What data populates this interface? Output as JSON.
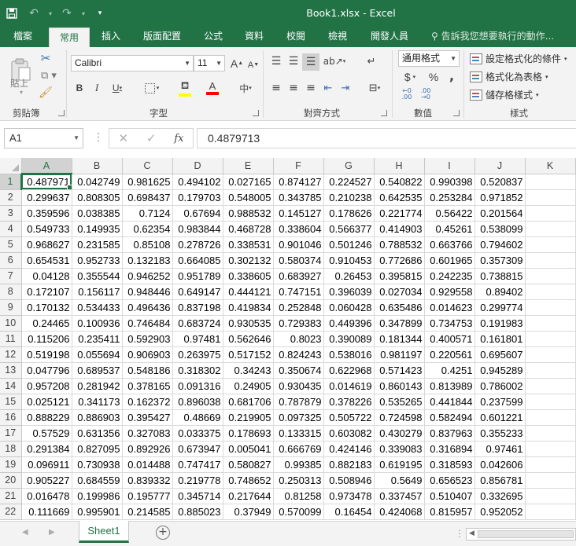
{
  "window": {
    "title": "Book1.xlsx - Excel"
  },
  "tabs": [
    {
      "label": "檔案",
      "key": "file"
    },
    {
      "label": "常用",
      "key": "home"
    },
    {
      "label": "插入",
      "key": "insert"
    },
    {
      "label": "版面配置",
      "key": "layout"
    },
    {
      "label": "公式",
      "key": "formulas"
    },
    {
      "label": "資料",
      "key": "data"
    },
    {
      "label": "校閱",
      "key": "review"
    },
    {
      "label": "檢視",
      "key": "view"
    },
    {
      "label": "開發人員",
      "key": "developer"
    }
  ],
  "tell_me": "告訴我您想要執行的動作...",
  "ribbon": {
    "clipboard": {
      "label": "剪貼簿",
      "paste": "貼上"
    },
    "font": {
      "label": "字型",
      "name": "Calibri",
      "size": "11"
    },
    "alignment": {
      "label": "對齊方式"
    },
    "number": {
      "label": "數值",
      "format": "通用格式",
      "currency": "$",
      "percent": "%",
      "comma": ","
    },
    "styles": {
      "label": "樣式",
      "conditional": "設定格式化的條件",
      "as_table": "格式化為表格",
      "cell_styles": "儲存格樣式"
    }
  },
  "formula_bar": {
    "name_box": "A1",
    "fx": "fx",
    "value": "0.4879713"
  },
  "grid": {
    "columns": [
      "A",
      "B",
      "C",
      "D",
      "E",
      "F",
      "G",
      "H",
      "I",
      "J",
      "K"
    ],
    "selected_column": "A",
    "selected_row": "1",
    "rows": [
      {
        "num": "1",
        "cells": [
          "0.487971",
          "0.042749",
          "0.981625",
          "0.494102",
          "0.027165",
          "0.874127",
          "0.224527",
          "0.540822",
          "0.990398",
          "0.520837",
          ""
        ]
      },
      {
        "num": "2",
        "cells": [
          "0.299637",
          "0.808305",
          "0.698437",
          "0.179703",
          "0.548005",
          "0.343785",
          "0.210238",
          "0.642535",
          "0.253284",
          "0.971852",
          ""
        ]
      },
      {
        "num": "3",
        "cells": [
          "0.359596",
          "0.038385",
          "0.7124",
          "0.67694",
          "0.988532",
          "0.145127",
          "0.178626",
          "0.221774",
          "0.56422",
          "0.201564",
          ""
        ]
      },
      {
        "num": "4",
        "cells": [
          "0.549733",
          "0.149935",
          "0.62354",
          "0.983844",
          "0.468728",
          "0.338604",
          "0.566377",
          "0.414903",
          "0.45261",
          "0.538099",
          ""
        ]
      },
      {
        "num": "5",
        "cells": [
          "0.968627",
          "0.231585",
          "0.85108",
          "0.278726",
          "0.338531",
          "0.901046",
          "0.501246",
          "0.788532",
          "0.663766",
          "0.794602",
          ""
        ]
      },
      {
        "num": "6",
        "cells": [
          "0.654531",
          "0.952733",
          "0.132183",
          "0.664085",
          "0.302132",
          "0.580374",
          "0.910453",
          "0.772686",
          "0.601965",
          "0.357309",
          ""
        ]
      },
      {
        "num": "7",
        "cells": [
          "0.04128",
          "0.355544",
          "0.946252",
          "0.951789",
          "0.338605",
          "0.683927",
          "0.26453",
          "0.395815",
          "0.242235",
          "0.738815",
          ""
        ]
      },
      {
        "num": "8",
        "cells": [
          "0.172107",
          "0.156117",
          "0.948446",
          "0.649147",
          "0.444121",
          "0.747151",
          "0.396039",
          "0.027034",
          "0.929558",
          "0.89402",
          ""
        ]
      },
      {
        "num": "9",
        "cells": [
          "0.170132",
          "0.534433",
          "0.496436",
          "0.837198",
          "0.419834",
          "0.252848",
          "0.060428",
          "0.635486",
          "0.014623",
          "0.299774",
          ""
        ]
      },
      {
        "num": "10",
        "cells": [
          "0.24465",
          "0.100936",
          "0.746484",
          "0.683724",
          "0.930535",
          "0.729383",
          "0.449396",
          "0.347899",
          "0.734753",
          "0.191983",
          ""
        ]
      },
      {
        "num": "11",
        "cells": [
          "0.115206",
          "0.235411",
          "0.592903",
          "0.97481",
          "0.562646",
          "0.8023",
          "0.390089",
          "0.181344",
          "0.400571",
          "0.161801",
          ""
        ]
      },
      {
        "num": "12",
        "cells": [
          "0.519198",
          "0.055694",
          "0.906903",
          "0.263975",
          "0.517152",
          "0.824243",
          "0.538016",
          "0.981197",
          "0.220561",
          "0.695607",
          ""
        ]
      },
      {
        "num": "13",
        "cells": [
          "0.047796",
          "0.689537",
          "0.548186",
          "0.318302",
          "0.34243",
          "0.350674",
          "0.622968",
          "0.571423",
          "0.4251",
          "0.945289",
          ""
        ]
      },
      {
        "num": "14",
        "cells": [
          "0.957208",
          "0.281942",
          "0.378165",
          "0.091316",
          "0.24905",
          "0.930435",
          "0.014619",
          "0.860143",
          "0.813989",
          "0.786002",
          ""
        ]
      },
      {
        "num": "15",
        "cells": [
          "0.025121",
          "0.341173",
          "0.162372",
          "0.896038",
          "0.681706",
          "0.787879",
          "0.378226",
          "0.535265",
          "0.441844",
          "0.237599",
          ""
        ]
      },
      {
        "num": "16",
        "cells": [
          "0.888229",
          "0.886903",
          "0.395427",
          "0.48669",
          "0.219905",
          "0.097325",
          "0.505722",
          "0.724598",
          "0.582494",
          "0.601221",
          ""
        ]
      },
      {
        "num": "17",
        "cells": [
          "0.57529",
          "0.631356",
          "0.327083",
          "0.033375",
          "0.178693",
          "0.133315",
          "0.603082",
          "0.430279",
          "0.837963",
          "0.355233",
          ""
        ]
      },
      {
        "num": "18",
        "cells": [
          "0.291384",
          "0.827095",
          "0.892926",
          "0.673947",
          "0.005041",
          "0.666769",
          "0.424146",
          "0.339083",
          "0.316894",
          "0.97461",
          ""
        ]
      },
      {
        "num": "19",
        "cells": [
          "0.096911",
          "0.730938",
          "0.014488",
          "0.747417",
          "0.580827",
          "0.99385",
          "0.882183",
          "0.619195",
          "0.318593",
          "0.042606",
          ""
        ]
      },
      {
        "num": "20",
        "cells": [
          "0.905227",
          "0.684559",
          "0.839332",
          "0.219778",
          "0.748652",
          "0.250313",
          "0.508946",
          "0.5649",
          "0.656523",
          "0.856781",
          ""
        ]
      },
      {
        "num": "21",
        "cells": [
          "0.016478",
          "0.199986",
          "0.195777",
          "0.345714",
          "0.217644",
          "0.81258",
          "0.973478",
          "0.337457",
          "0.510407",
          "0.332695",
          ""
        ]
      },
      {
        "num": "22",
        "cells": [
          "0.111669",
          "0.995901",
          "0.214585",
          "0.885023",
          "0.37949",
          "0.570099",
          "0.16454",
          "0.424068",
          "0.815957",
          "0.952052",
          ""
        ]
      }
    ]
  },
  "sheets": [
    "Sheet1"
  ],
  "colors": {
    "accent": "#217346",
    "ribbon_bg": "#f3f3f3"
  }
}
